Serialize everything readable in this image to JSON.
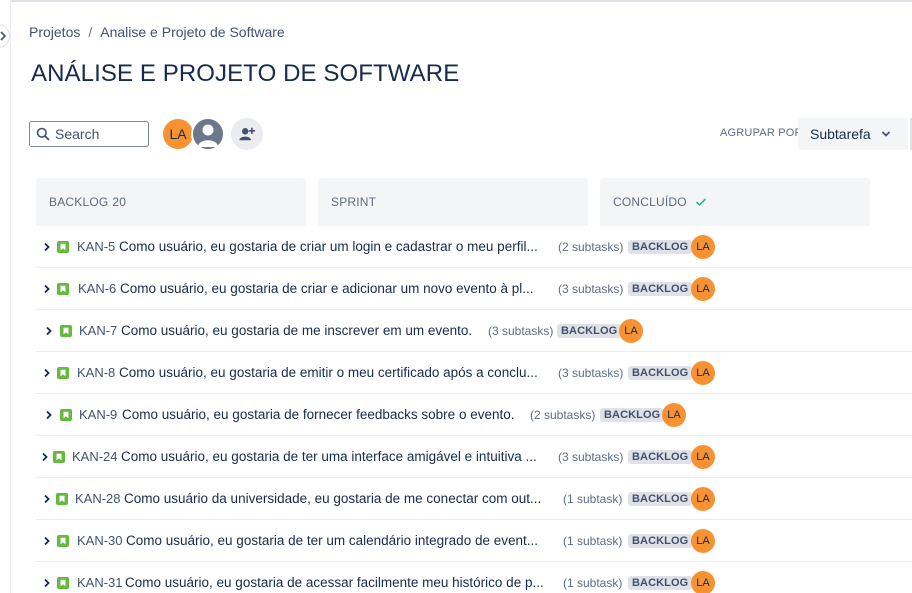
{
  "breadcrumb": {
    "root": "Projetos",
    "separator": "/",
    "current": "Analise e Projeto de Software"
  },
  "page": {
    "title": "ANÁLISE E PROJETO DE SOFTWARE"
  },
  "search": {
    "placeholder": "Search"
  },
  "people": {
    "avatar_initials": "LA",
    "ghost_icon": "user-avatar-icon",
    "add_icon": "add-people-icon"
  },
  "group_by": {
    "label": "AGRUPAR POR",
    "value": "Subtarefa"
  },
  "columns": [
    {
      "name": "BACKLOG",
      "count": "20"
    },
    {
      "name": "SPRINT"
    },
    {
      "name": "CONCLUÍDO"
    }
  ],
  "colors": {
    "accent": "#0052cc",
    "story": "#63ba3c",
    "avatar": "#f79233",
    "check": "#36b37e"
  },
  "issues": [
    {
      "key": "KAN-5",
      "summary": "Como usuário, eu gostaria de criar um login e cadastrar o meu perfil...",
      "subtasks": "(2 subtasks)",
      "status": "BACKLOG",
      "assignee": "LA"
    },
    {
      "key": "KAN-6",
      "summary": "Como usuário, eu gostaria de criar e adicionar um novo evento à pl...",
      "subtasks": "(3 subtasks)",
      "status": "BACKLOG",
      "assignee": "LA"
    },
    {
      "key": "KAN-7",
      "summary": "Como usuário, eu gostaria de me inscrever em um evento.",
      "subtasks": "(3 subtasks)",
      "status": "BACKLOG",
      "assignee": "LA"
    },
    {
      "key": "KAN-8",
      "summary": "Como usuário, eu gostaria de emitir o meu certificado após a conclu...",
      "subtasks": "(3 subtasks)",
      "status": "BACKLOG",
      "assignee": "LA"
    },
    {
      "key": "KAN-9",
      "summary": "Como usuário, eu gostaria de fornecer feedbacks sobre o evento.",
      "subtasks": "(2 subtasks)",
      "status": "BACKLOG",
      "assignee": "LA"
    },
    {
      "key": "KAN-24",
      "summary": "Como usuário, eu gostaria de ter uma interface amigável e intuitiva ...",
      "subtasks": "(3 subtasks)",
      "status": "BACKLOG",
      "assignee": "LA"
    },
    {
      "key": "KAN-28",
      "summary": "Como usuário da universidade, eu gostaria de me conectar com out...",
      "subtasks": "(1 subtask)",
      "status": "BACKLOG",
      "assignee": "LA"
    },
    {
      "key": "KAN-30",
      "summary": "Como usuário, eu gostaria de ter um calendário integrado de event...",
      "subtasks": "(1 subtask)",
      "status": "BACKLOG",
      "assignee": "LA"
    },
    {
      "key": "KAN-31",
      "summary": "Como usuário, eu gostaria de acessar facilmente meu histórico de p...",
      "subtasks": "(1 subtask)",
      "status": "BACKLOG",
      "assignee": "LA"
    }
  ]
}
